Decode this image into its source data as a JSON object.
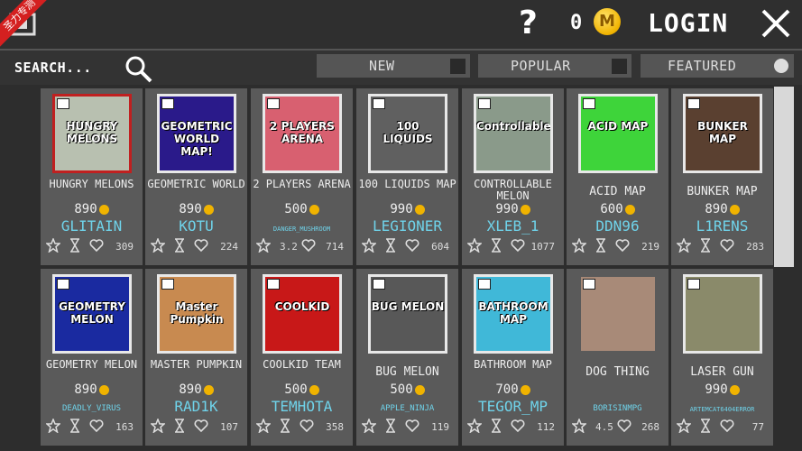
{
  "topbar": {
    "badge": "圣力专测",
    "help_glyph": "?",
    "coins": "0",
    "coin_symbol": "M",
    "login_label": "LOGIN"
  },
  "search": {
    "placeholder": "SEARCH..."
  },
  "filters": {
    "new": "NEW",
    "popular": "POPULAR",
    "featured": "FEATURED"
  },
  "items": [
    {
      "name": "HUNGRY MELONS",
      "price": "890",
      "author": "GLITAIN",
      "rating": "",
      "likes": "309",
      "thumb_text": "HUNGRY MELONS",
      "thumb_bg": "#b8c0b0",
      "border": "#c02020"
    },
    {
      "name": "GEOMETRIC WORLD",
      "price": "890",
      "author": "KOTU",
      "rating": "",
      "likes": "224",
      "thumb_text": "GEOMETRIC WORLD MAP!",
      "thumb_bg": "#2a1a8a",
      "border": "#e8e8e8"
    },
    {
      "name": "2 PLAYERS ARENA",
      "price": "500",
      "author": "DANGER_MUSHROOM",
      "rating": "3.2",
      "likes": "714",
      "thumb_text": "2 PLAYERS ARENA",
      "thumb_bg": "#d86070",
      "border": "#e8e8e8"
    },
    {
      "name": "100 LIQUIDS MAP",
      "price": "990",
      "author": "LEGIONER",
      "rating": "",
      "likes": "604",
      "thumb_text": "100 LIQUIDS",
      "thumb_bg": "#606060",
      "border": "#e8e8e8"
    },
    {
      "name": "CONTROLLABLE MELON",
      "price": "990",
      "author": "XLEB_1",
      "rating": "",
      "likes": "1077",
      "thumb_text": "Controllable",
      "thumb_bg": "#8a9a8a",
      "border": "#e8e8e8"
    },
    {
      "name": "ACID MAP",
      "price": "600",
      "author": "DDN96",
      "rating": "",
      "likes": "219",
      "thumb_text": "ACID MAP",
      "thumb_bg": "#3ed43a",
      "border": "#e8e8e8"
    },
    {
      "name": "BUNKER MAP",
      "price": "890",
      "author": "L1RENS",
      "rating": "",
      "likes": "283",
      "thumb_text": "BUNKER MAP",
      "thumb_bg": "#5a4030",
      "border": "#e8e8e8"
    },
    {
      "name": "GEOMETRY MELON",
      "price": "890",
      "author": "DEADLY_VIRUS",
      "rating": "",
      "likes": "163",
      "thumb_text": "GEOMETRY MELON",
      "thumb_bg": "#1a2aa0",
      "border": "#e8e8e8"
    },
    {
      "name": "MASTER PUMPKIN",
      "price": "890",
      "author": "RAD1K",
      "rating": "",
      "likes": "107",
      "thumb_text": "Master Pumpkin",
      "thumb_bg": "#c88a50",
      "border": "#e8e8e8"
    },
    {
      "name": "COOLKID TEAM",
      "price": "500",
      "author": "TEMHOTA",
      "rating": "",
      "likes": "358",
      "thumb_text": "COOLKID",
      "thumb_bg": "#c81818",
      "border": "#e8e8e8"
    },
    {
      "name": "BUG MELON",
      "price": "500",
      "author": "APPLE_NINJA",
      "rating": "",
      "likes": "119",
      "thumb_text": "BUG MELON",
      "thumb_bg": "#585858",
      "border": "#e8e8e8"
    },
    {
      "name": "BATHROOM MAP",
      "price": "700",
      "author": "TEGOR_MP",
      "rating": "",
      "likes": "112",
      "thumb_text": "BATHROOM MAP",
      "thumb_bg": "#40b8d8",
      "border": "#e8e8e8"
    },
    {
      "name": "DOG THING",
      "price": "",
      "author": "BORISINMPG",
      "rating": "4.5",
      "likes": "268",
      "thumb_text": "",
      "thumb_bg": "#a88a78",
      "border": "#5a5a5a"
    },
    {
      "name": "LASER GUN",
      "price": "990",
      "author": "ARTEMCAT6404ERROR",
      "rating": "",
      "likes": "77",
      "thumb_text": "",
      "thumb_bg": "#8a8a6a",
      "border": "#e8e8e8"
    }
  ],
  "icons": {
    "back": "back-icon",
    "close": "close-icon",
    "search": "search-icon",
    "star": "star-icon",
    "hourglass": "hourglass-icon",
    "heart": "heart-icon"
  },
  "colors": {
    "author": "#6fd3ea",
    "coin": "#f0b300",
    "card": "#5a5a5a",
    "topbar": "#2f2f2f"
  }
}
